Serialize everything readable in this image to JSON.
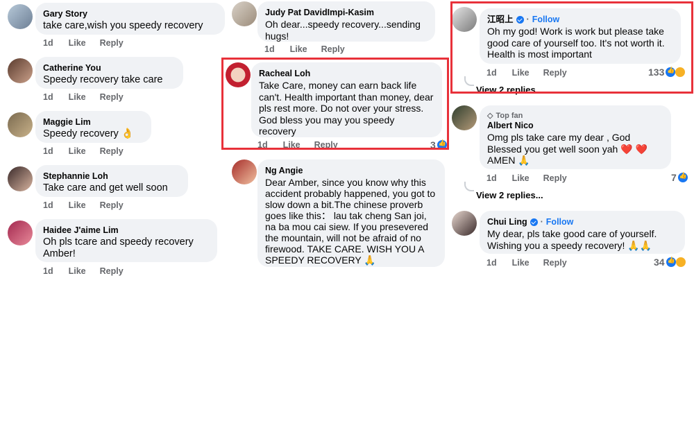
{
  "colors": {
    "bubble": "#f0f2f5",
    "meta": "#65676b",
    "link": "#1877f2",
    "highlight": "#e8313a"
  },
  "actions": {
    "like": "Like",
    "reply": "Reply"
  },
  "col1": [
    {
      "author": "Gary Story",
      "text": "take care,wish you speedy recovery",
      "time": "1d"
    },
    {
      "author": "Catherine You",
      "text": "Speedy recovery take care",
      "time": "1d"
    },
    {
      "author": "Maggie Lim",
      "text": "Speedy recovery 👌",
      "time": "1d"
    },
    {
      "author": "Stephannie Loh",
      "text": "Take care and get well soon",
      "time": "1d"
    },
    {
      "author": "Haidee J'aime Lim",
      "text": "Oh pls tcare and speedy recovery Amber!",
      "time": "1d"
    }
  ],
  "col2": [
    {
      "author": "Judy Pat DavidImpi-Kasim",
      "text": "Oh dear...speedy recovery...sending hugs!",
      "time": "1d"
    },
    {
      "author": "Racheal Loh",
      "text": "Take Care, money can earn back life can't. Health important than money, dear pls rest more. Do not over your stress. God bless you may you speedy recovery",
      "time": "1d",
      "count": "3"
    },
    {
      "author": "Ng Angie",
      "text": "Dear Amber, since you know why this accident probably happened, you got to slow down a bit.The chinese proverb goes like this： lau tak cheng San joi, na ba mou cai siew.  If you presevered the mountain,  will not be afraid of no firewood. TAKE CARE. WISH YOU A SPEEDY RECOVERY 🙏"
    }
  ],
  "col3": [
    {
      "author": "江昭上",
      "follow": "Follow",
      "text": "Oh my god! Work is work but please take good care of yourself too. It's not worth it. Health is most important",
      "time": "1d",
      "count": "133",
      "view_replies": "View 2 replies..."
    },
    {
      "badge": "Top fan",
      "author": "Albert Nico",
      "text": "Omg pls take care my dear , God Blessed you get well soon yah ❤️ ❤️ AMEN 🙏",
      "time": "1d",
      "count": "7",
      "view_replies": "View 2 replies..."
    },
    {
      "author": "Chui Ling",
      "follow": "Follow",
      "text": "My dear, pls take good care of yourself. Wishing you a speedy recovery! 🙏🙏",
      "time": "1d",
      "count": "34"
    }
  ],
  "separator": "·"
}
